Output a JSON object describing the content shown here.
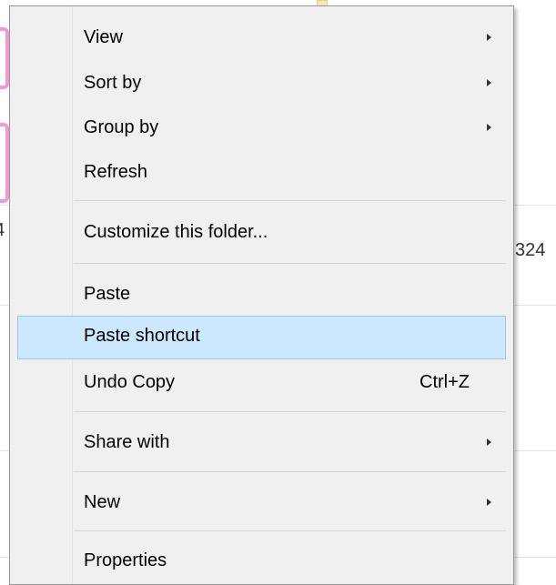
{
  "background": {
    "left_fragment": "4",
    "right_fragment": "324"
  },
  "menu": {
    "items": [
      {
        "label": "View",
        "submenu": true
      },
      {
        "label": "Sort by",
        "submenu": true
      },
      {
        "label": "Group by",
        "submenu": true
      },
      {
        "label": "Refresh"
      },
      {
        "label": "Customize this folder..."
      },
      {
        "label": "Paste"
      },
      {
        "label": "Paste shortcut",
        "selected": true
      },
      {
        "label": "Undo Copy",
        "shortcut": "Ctrl+Z"
      },
      {
        "label": "Share with",
        "submenu": true
      },
      {
        "label": "New",
        "submenu": true
      },
      {
        "label": "Properties"
      }
    ]
  },
  "colors": {
    "menu_bg": "#f0f0f0",
    "selection_bg": "#cce8ff",
    "selection_border": "#99c9ef"
  }
}
